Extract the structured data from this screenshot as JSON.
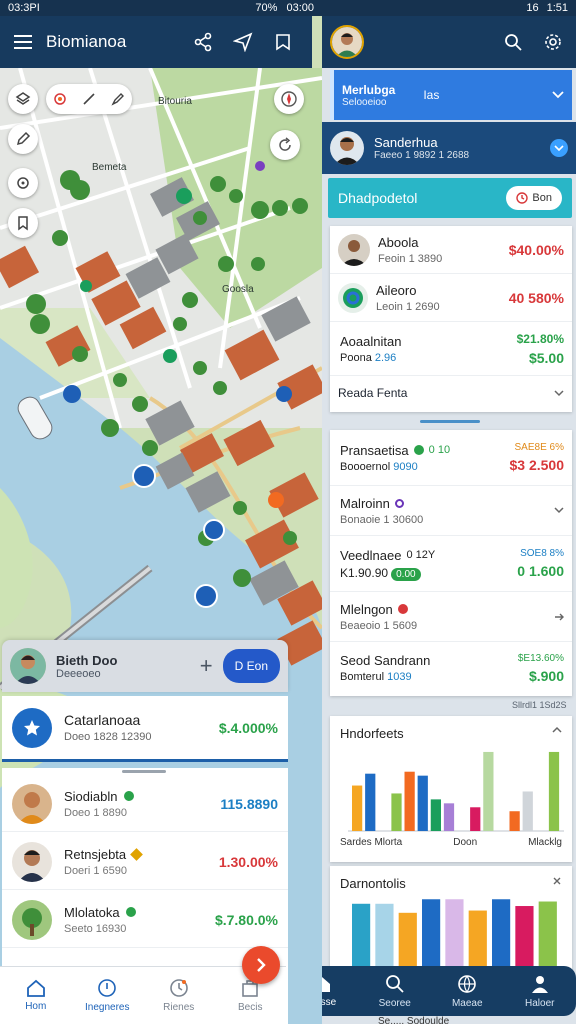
{
  "left_status": {
    "time": "03:3PI",
    "battery": "70%",
    "clock": "03:00"
  },
  "left_appbar": {
    "title": "Biomianoa"
  },
  "map": {
    "poi_label_1": "Bitouria",
    "poi_label_2": "Goosla",
    "poi_label_3": "Bemeta"
  },
  "sheet": {
    "user_name": "Bieth Doo",
    "user_sub": "Deeeoeo",
    "action_label": "D Eon",
    "top_card": {
      "title": "Catarlanoaa",
      "sub": "Doeo 1828 12390",
      "value": "$.4.000%"
    },
    "rows": [
      {
        "name": "Siodiabln",
        "sub": "Doeo 1 8890",
        "value": "115.8890",
        "value_color": "blue",
        "dot": "#2aa24a"
      },
      {
        "name": "Retnsjebta",
        "sub": "Doeri 1 6590",
        "value": "1.30.00%",
        "value_color": "red",
        "dot": "#e0a300"
      },
      {
        "name": "Mlolatoka",
        "sub": "Seeto 16930",
        "value": "$.7.80.0%",
        "value_color": "green",
        "dot": "#2aa24a"
      }
    ]
  },
  "left_nav": [
    {
      "label": "Hom",
      "icon": "home-icon"
    },
    {
      "label": "Inegneres",
      "icon": "compass-icon"
    },
    {
      "label": "Rienes",
      "icon": "clock-icon"
    },
    {
      "label": "Becis",
      "icon": "bag-icon"
    }
  ],
  "right_status": {
    "time": "1:51",
    "signal": "16"
  },
  "accounts": {
    "first": {
      "name": "Merlubga",
      "sub": "Selooeioo",
      "tag": "Ias"
    },
    "second": {
      "name": "Sanderhua",
      "sub": "Faeeo 1 9892 1 2688"
    }
  },
  "dashboard": {
    "title": "Dhadpodetol",
    "chip": "Bon"
  },
  "top_list": [
    {
      "name": "Aboola",
      "sub": "Feoin 1 3890",
      "value": "$40.00%",
      "color": "red"
    },
    {
      "name": "Aileoro",
      "sub": "Leoin 1 2690",
      "value": "40 580%",
      "color": "red"
    }
  ],
  "top_list_extra": {
    "name": "Aoaalnitan",
    "sub": "Poona",
    "sub_val": "2.96",
    "value": "$21.80%",
    "value2": "$5.00"
  },
  "top_list_footer": "Reada Fenta",
  "mid_list": [
    {
      "name": "Pransaetisa",
      "badge": "0 10",
      "sub": "Boooernol",
      "sub_val": "9090",
      "value": "SAE8E 6%",
      "value2": "$3 2.500",
      "dot": "#2aa24a",
      "c1": "#e08a1a",
      "c2": "#d8383a"
    },
    {
      "name": "Malroinn",
      "badge": "",
      "sub": "Bonaoie 1 30600",
      "value": "",
      "value2": "",
      "dot": "#6a35b8",
      "c1": "",
      "c2": ""
    },
    {
      "name": "Veedlnaee",
      "badge": "0 12Y",
      "sub": "K1.90.90",
      "sub_pill": "0.00",
      "value": "SOE8 8%",
      "value2": "0 1.600",
      "dot": "",
      "c1": "#1c7fc4",
      "c2": "#2aa24a"
    },
    {
      "name": "Mlelngon",
      "badge": "",
      "sub": "Beaeoio 1 5609",
      "value": "",
      "value2": "",
      "dot": "#d8383a",
      "c1": "",
      "c2": ""
    },
    {
      "name": "Seod Sandrann",
      "badge": "",
      "sub": "Bomterul",
      "sub_val": "1039",
      "value": "$E13.60%",
      "value2": "$.900",
      "dot": "",
      "c1": "#2aa24a",
      "c2": "#2aa24a"
    }
  ],
  "mid_caption": "Sllrdl1 1Sd2S",
  "chart1": {
    "title": "Hndorfeets",
    "xlabels": [
      "Sardes Mlorta",
      "Doon",
      "Mlacklg"
    ]
  },
  "chart2": {
    "title": "Darnontolis"
  },
  "chart_data": [
    {
      "type": "bar",
      "title": "Hndorfeets",
      "categories": [
        "Sardes Mlorta",
        "Doon",
        "Mlacklg"
      ],
      "series": [
        {
          "values": [
            46,
            58,
            0,
            38,
            60,
            56,
            32,
            28,
            0,
            24,
            80,
            0,
            20,
            40,
            0,
            80
          ]
        }
      ],
      "colors": [
        "#f5a623",
        "#1e6bc4",
        "#ffffff",
        "#8bc34a",
        "#f26a21",
        "#1e6bc4",
        "#1a9e5c",
        "#a77fd6",
        "#4a6fd6",
        "#d81b60",
        "#b7d9a0",
        "#ffffff",
        "#f26a21",
        "#d0d5da",
        "#b7d9a0",
        "#8bc34a"
      ]
    },
    {
      "type": "bar",
      "title": "Darnontolis",
      "series": [
        {
          "values": [
            56,
            56,
            48,
            60,
            60,
            50,
            60,
            54,
            58
          ]
        }
      ],
      "colors": [
        "#2aa2c7",
        "#a7d4e8",
        "#f5a623",
        "#1e6bc4",
        "#d9b8e8",
        "#f5a623",
        "#1e6bc4",
        "#d81b60",
        "#8bc34a"
      ]
    }
  ],
  "right_nav": [
    {
      "label": "Bosse",
      "icon": "home-icon"
    },
    {
      "label": "Seoree",
      "icon": "search-icon"
    },
    {
      "label": "Maeae",
      "icon": "globe-icon"
    },
    {
      "label": "Haloer",
      "icon": "person-icon"
    }
  ],
  "footer_caption": "Se..... Sodoulde"
}
